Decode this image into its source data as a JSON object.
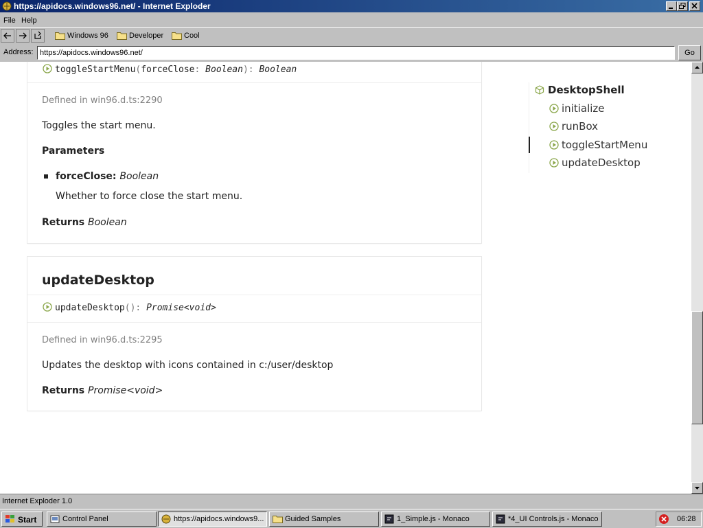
{
  "window": {
    "title": "https://apidocs.windows96.net/ - Internet Exploder"
  },
  "menu": [
    "File",
    "Help"
  ],
  "toolbar": {
    "bookmarks": [
      "Windows 96",
      "Developer",
      "Cool"
    ]
  },
  "address": {
    "label": "Address:",
    "value": "https://apidocs.windows96.net/",
    "go_label": "Go"
  },
  "toggle_card": {
    "signature": {
      "name": "toggleStartMenu",
      "open": "(",
      "param": "forceClose",
      "colon": ": ",
      "param_type": "Boolean",
      "close": "): ",
      "return_type": "Boolean"
    },
    "defined": "Defined in win96.d.ts:2290",
    "description": "Toggles the start menu.",
    "parameters_heading": "Parameters",
    "param_name": "forceClose: ",
    "param_type": "Boolean",
    "param_desc": "Whether to force close the start menu.",
    "returns_label": "Returns ",
    "returns_type": "Boolean"
  },
  "update_card": {
    "title": "updateDesktop",
    "signature": {
      "name": "updateDesktop",
      "parens": "(): ",
      "return_type": "Promise<void>"
    },
    "defined": "Defined in win96.d.ts:2295",
    "description": "Updates the desktop with icons contained in c:/user/desktop",
    "returns_label": "Returns ",
    "returns_type": "Promise<void>"
  },
  "toc": {
    "parent": "DesktopShell",
    "items": [
      "initialize",
      "runBox",
      "toggleStartMenu",
      "updateDesktop"
    ],
    "active_index": 2
  },
  "status": {
    "text": "Internet Exploder 1.0"
  },
  "taskbar": {
    "start_label": "Start",
    "tasks": [
      "Control Panel",
      "https://apidocs.windows9...",
      "Guided Samples",
      "1_Simple.js - Monaco",
      "*4_UI Controls.js - Monaco"
    ],
    "active_task_index": 1,
    "clock": "06:28"
  },
  "colors": {
    "titlebar_start": "#0a246a",
    "titlebar_end": "#3a6ea5",
    "icon_green": "#8aa64a"
  }
}
